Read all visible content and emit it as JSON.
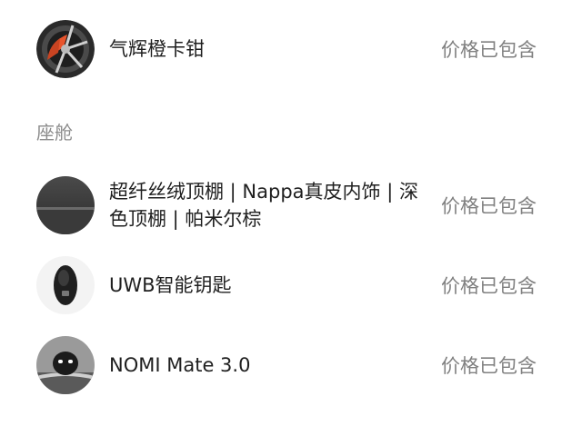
{
  "items_top": [
    {
      "name": "气辉橙卡钳",
      "price": "价格已包含",
      "icon": "brake-caliper-icon"
    }
  ],
  "section": {
    "title": "座舱"
  },
  "items_cabin": [
    {
      "name": "超纤丝绒顶棚 | Nappa真皮内饰 | 深色顶棚 | 帕米尔棕",
      "price": "价格已包含",
      "icon": "headliner-fabric-icon"
    },
    {
      "name": "UWB智能钥匙",
      "price": "价格已包含",
      "icon": "smart-key-icon"
    },
    {
      "name": "NOMI Mate 3.0",
      "price": "价格已包含",
      "icon": "nomi-robot-icon"
    }
  ],
  "colors": {
    "caliper_orange": "#e8542c",
    "price_text": "#808080",
    "section_text": "#8c8c8c"
  }
}
